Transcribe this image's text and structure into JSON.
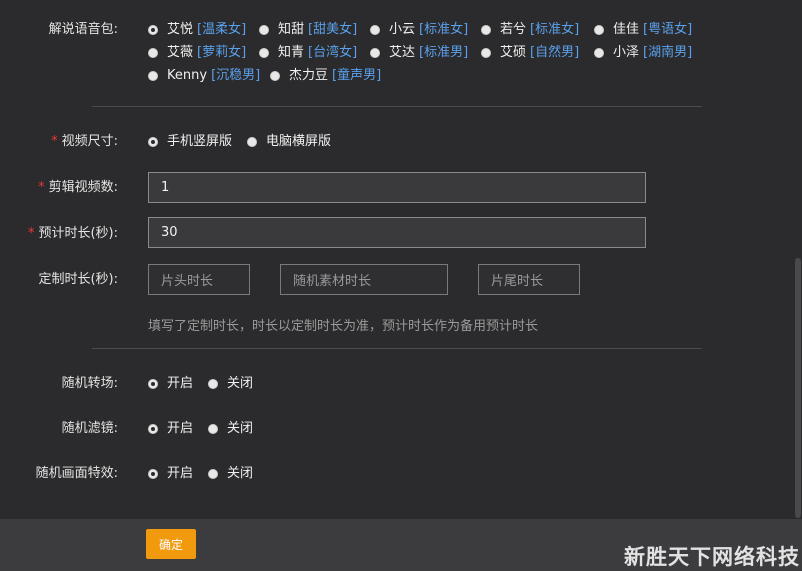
{
  "voice": {
    "label": "解说语音包:",
    "rows": [
      [
        {
          "name": "艾悦",
          "tag": "[温柔女]",
          "selected": true
        },
        {
          "name": "知甜",
          "tag": "[甜美女]",
          "selected": false
        },
        {
          "name": "小云",
          "tag": "[标准女]",
          "selected": false
        },
        {
          "name": "若兮",
          "tag": "[标准女]",
          "selected": false
        },
        {
          "name": "佳佳",
          "tag": "[粤语女]",
          "selected": false
        }
      ],
      [
        {
          "name": "艾薇",
          "tag": "[萝莉女]",
          "selected": false
        },
        {
          "name": "知青",
          "tag": "[台湾女]",
          "selected": false
        },
        {
          "name": "艾达",
          "tag": "[标准男]",
          "selected": false
        },
        {
          "name": "艾硕",
          "tag": "[自然男]",
          "selected": false
        },
        {
          "name": "小泽",
          "tag": "[湖南男]",
          "selected": false
        }
      ],
      [
        {
          "name": "Kenny",
          "tag": "[沉稳男]",
          "selected": false
        },
        {
          "name": "杰力豆",
          "tag": "[童声男]",
          "selected": false
        }
      ]
    ]
  },
  "video_size": {
    "label": "视频尺寸:",
    "options": [
      {
        "name": "手机竖屏版",
        "selected": true
      },
      {
        "name": "电脑横屏版",
        "selected": false
      }
    ]
  },
  "clip_count": {
    "label": "剪辑视频数:",
    "value": "1"
  },
  "estimated_duration": {
    "label": "预计时长(秒):",
    "value": "30"
  },
  "custom_duration": {
    "label": "定制时长(秒):",
    "head_placeholder": "片头时长",
    "random_placeholder": "随机素材时长",
    "tail_placeholder": "片尾时长",
    "hint": "填写了定制时长，时长以定制时长为准，预计时长作为备用预计时长"
  },
  "random_transition": {
    "label": "随机转场:",
    "on": "开启",
    "off": "关闭",
    "selected": "on"
  },
  "random_filter": {
    "label": "随机滤镜:",
    "on": "开启",
    "off": "关闭",
    "selected": "on"
  },
  "random_effects": {
    "label": "随机画面特效:",
    "on": "开启",
    "off": "关闭",
    "selected": "on"
  },
  "footer": {
    "confirm_label": "确定"
  },
  "watermark": "新胜天下网络科技",
  "colors": {
    "accent": "#f29a0e",
    "tag": "#5aa0ea",
    "required": "#e53935",
    "background": "#2b2b2d"
  }
}
